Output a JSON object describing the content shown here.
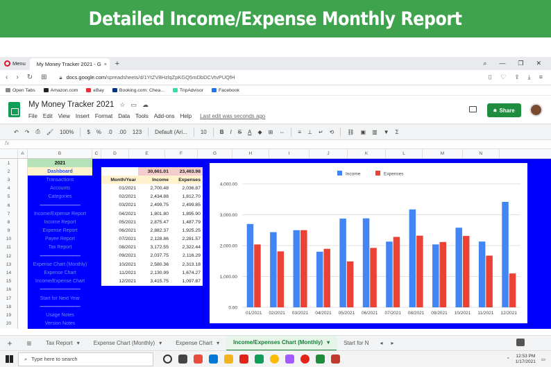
{
  "banner": {
    "title": "Detailed Income/Expense Monthly Report"
  },
  "browser": {
    "menu_label": "Menu",
    "tab_title": "My Money Tracker 2021 - G",
    "url_host": "docs.google.com",
    "url_path": "/spreadsheets/d/1YtZV8HzlqZpKGQ5mDbDCVtvPUQfH",
    "bookmarks": [
      {
        "label": "Open Tabs",
        "color": "#888"
      },
      {
        "label": "Amazon.com",
        "color": "#222"
      },
      {
        "label": "eBay",
        "color": "#e53238"
      },
      {
        "label": "Booking.com: Chea...",
        "color": "#003580"
      },
      {
        "label": "TripAdvisor",
        "color": "#34e0a1"
      },
      {
        "label": "Facebook",
        "color": "#1877f2"
      }
    ]
  },
  "sheets": {
    "title": "My Money Tracker 2021",
    "menus": [
      "File",
      "Edit",
      "View",
      "Insert",
      "Format",
      "Data",
      "Tools",
      "Add-ons",
      "Help"
    ],
    "last_edit": "Last edit was seconds ago",
    "share_label": "Share",
    "toolbar": {
      "zoom": "100%",
      "currency": "$",
      "percent": "%",
      "dec1": ".0",
      "dec2": ".00",
      "numfmt": "123",
      "font": "Default (Ari...",
      "size": "10",
      "bold": "B",
      "italic": "I",
      "strike": "S",
      "color": "A"
    },
    "fx_label": "fx"
  },
  "columns": [
    "A",
    "B",
    "C",
    "D",
    "E",
    "F",
    "G",
    "H",
    "I",
    "J",
    "K",
    "L",
    "M",
    "N"
  ],
  "rows": [
    "1",
    "2",
    "3",
    "4",
    "5",
    "6",
    "7",
    "8",
    "9",
    "10",
    "11",
    "12",
    "13",
    "14",
    "15",
    "16",
    "17",
    "18",
    "19",
    "20"
  ],
  "nav": {
    "year": "2021",
    "items": [
      "Dashboard",
      "Transactions",
      "Accounts",
      "Categories",
      "--------------------------------",
      "Income/Expense Report",
      "Income Report",
      "Expense Report",
      "Payee Report",
      "Tax Report",
      "--------------------------------",
      "Expense Chart (Monthly)",
      "Expense Chart",
      "Income/Expense Chart",
      "--------------------------------",
      "Start for Next Year",
      "--------------------------------",
      "Usage Notes",
      "Version Notes"
    ]
  },
  "table": {
    "totals": {
      "income": "30,661.01",
      "expenses": "23,463.98"
    },
    "headers": {
      "month": "Month/Year",
      "income": "Income",
      "expenses": "Expenses"
    },
    "rows": [
      {
        "m": "01/2021",
        "i": "2,700.48",
        "e": "2,036.87"
      },
      {
        "m": "02/2021",
        "i": "2,434.88",
        "e": "1,812.70"
      },
      {
        "m": "03/2021",
        "i": "2,499.75",
        "e": "2,499.85"
      },
      {
        "m": "04/2021",
        "i": "1,801.80",
        "e": "1,895.90"
      },
      {
        "m": "05/2021",
        "i": "2,875.47",
        "e": "1,487.79"
      },
      {
        "m": "06/2021",
        "i": "2,882.37",
        "e": "1,925.25"
      },
      {
        "m": "07/2021",
        "i": "2,128.86",
        "e": "2,281.57"
      },
      {
        "m": "08/2021",
        "i": "3,172.55",
        "e": "2,322.44"
      },
      {
        "m": "09/2021",
        "i": "2,037.75",
        "e": "2,116.29"
      },
      {
        "m": "10/2021",
        "i": "2,580.36",
        "e": "2,313.18"
      },
      {
        "m": "11/2021",
        "i": "2,130.99",
        "e": "1,674.27"
      },
      {
        "m": "12/2021",
        "i": "3,415.75",
        "e": "1,097.87"
      }
    ]
  },
  "chart_data": {
    "type": "bar",
    "categories": [
      "01/2021",
      "02/2021",
      "03/2021",
      "04/2021",
      "05/2021",
      "06/2021",
      "07/2021",
      "08/2021",
      "09/2021",
      "10/2021",
      "11/2021",
      "12/2021"
    ],
    "series": [
      {
        "name": "Income",
        "color": "#4285f4",
        "values": [
          2700.48,
          2434.88,
          2499.75,
          1801.8,
          2875.47,
          2882.37,
          2128.86,
          3172.55,
          2037.75,
          2580.36,
          2130.99,
          3415.75
        ]
      },
      {
        "name": "Expenses",
        "color": "#ea4335",
        "values": [
          2036.87,
          1812.7,
          2499.85,
          1895.9,
          1487.79,
          1925.25,
          2281.57,
          2322.44,
          2116.29,
          2313.18,
          1674.27,
          1097.87
        ]
      }
    ],
    "yticks": [
      "0.00",
      "1,000.00",
      "2,000.00",
      "3,000.00",
      "4,000.00"
    ],
    "ylim": [
      0,
      4000
    ],
    "legend": "top-center",
    "grid": true
  },
  "sheet_tabs": [
    "Tax Report",
    "Expense Chart (Monthly)",
    "Expense Chart",
    "Income/Expenses Chart (Monthly)",
    "Start for N"
  ],
  "active_tab": 3,
  "taskbar": {
    "search": "Type here to search",
    "time": "12:53 PM",
    "date": "1/17/2021"
  }
}
